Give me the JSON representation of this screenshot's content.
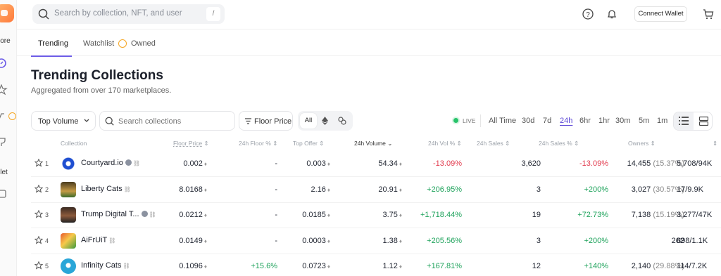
{
  "rail": {
    "explore_label": "lore",
    "wallet_label": "llet"
  },
  "search": {
    "placeholder": "Search by collection, NFT, and user",
    "shortcut": "/"
  },
  "header": {
    "connect_label": "Connect Wallet"
  },
  "tabs": [
    {
      "label": "Trending",
      "active": true
    },
    {
      "label": "Watchlist",
      "active": false
    },
    {
      "label": "Owned",
      "active": false
    }
  ],
  "page": {
    "title": "Trending Collections",
    "subtitle": "Aggregated from over 170 marketplaces."
  },
  "filters": {
    "sort": "Top Volume",
    "search_placeholder": "Search collections",
    "floor_price": "Floor Price",
    "chain_all": "All",
    "live": "LIVE"
  },
  "timeframes": [
    "All Time",
    "30d",
    "7d",
    "24h",
    "6hr",
    "1hr",
    "30m",
    "5m",
    "1m"
  ],
  "active_timeframe": "24h",
  "columns": {
    "collection": "Collection",
    "floor": "Floor Price",
    "floor_pct": "24h Floor %",
    "top_offer": "Top Offer",
    "volume": "24h Volume",
    "vol_pct": "24h Vol %",
    "sales": "24h Sales",
    "sales_pct": "24h Sales %",
    "owners": "Owners"
  },
  "rows": [
    {
      "rank": "1",
      "name": "Courtyard.io",
      "verified": true,
      "floor": "0.002",
      "floor_pct": "-",
      "top_offer": "0.003",
      "volume": "54.34",
      "vol_pct": "-13.09%",
      "sales": "3,620",
      "sales_pct": "-13.09%",
      "owners": "14,455",
      "owners_pct": "(15.37%)",
      "listed": "5,708/94K"
    },
    {
      "rank": "2",
      "name": "Liberty Cats",
      "verified": false,
      "floor": "8.0168",
      "floor_pct": "-",
      "top_offer": "2.16",
      "volume": "20.91",
      "vol_pct": "+206.95%",
      "sales": "3",
      "sales_pct": "+200%",
      "owners": "3,027",
      "owners_pct": "(30.57%)",
      "listed": "17/9.9K"
    },
    {
      "rank": "3",
      "name": "Trump Digital T...",
      "verified": true,
      "floor": "0.0212",
      "floor_pct": "-",
      "top_offer": "0.0185",
      "volume": "3.75",
      "vol_pct": "+1,718.44%",
      "sales": "19",
      "sales_pct": "+72.73%",
      "owners": "7,138",
      "owners_pct": "(15.19%)",
      "listed": "3,277/47K"
    },
    {
      "rank": "4",
      "name": "AiFrUiT",
      "verified": false,
      "floor": "0.0149",
      "floor_pct": "-",
      "top_offer": "0.0003",
      "volume": "1.38",
      "vol_pct": "+205.56%",
      "sales": "3",
      "sales_pct": "+200%",
      "owners": "262",
      "owners_pct": "",
      "listed": "898/1.1K"
    },
    {
      "rank": "5",
      "name": "Infinity Cats",
      "verified": false,
      "floor": "0.1096",
      "floor_pct": "+15.6%",
      "top_offer": "0.0723",
      "volume": "1.12",
      "vol_pct": "+167.81%",
      "sales": "12",
      "sales_pct": "+140%",
      "owners": "2,140",
      "owners_pct": "(29.88%)",
      "listed": "114/7.2K"
    }
  ],
  "colors": {
    "accent": "#6c5ce7",
    "negative": "#e23b4e",
    "positive": "#1fa35c"
  }
}
